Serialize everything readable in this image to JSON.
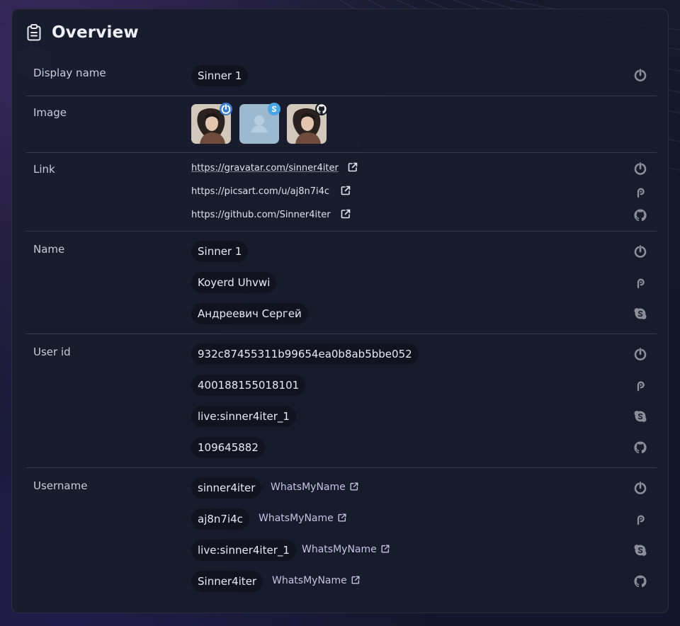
{
  "header": {
    "title": "Overview",
    "icon": "clipboard-icon"
  },
  "display_name": {
    "label": "Display name",
    "entries": [
      {
        "value": "Sinner 1",
        "service": "gravatar"
      }
    ]
  },
  "image": {
    "label": "Image",
    "avatars": [
      {
        "alt": "gravatar avatar",
        "badge": "gravatar"
      },
      {
        "alt": "skype default avatar",
        "badge": "skype"
      },
      {
        "alt": "github avatar",
        "badge": "github"
      }
    ]
  },
  "link": {
    "label": "Link",
    "entries": [
      {
        "url": "https://gravatar.com/sinner4iter",
        "service": "gravatar"
      },
      {
        "url": "https://picsart.com/u/aj8n7i4c",
        "service": "picsart"
      },
      {
        "url": "https://github.com/Sinner4iter",
        "service": "github"
      }
    ]
  },
  "name": {
    "label": "Name",
    "entries": [
      {
        "value": "Sinner 1",
        "service": "gravatar"
      },
      {
        "value": "Koyerd Uhvwi",
        "service": "picsart"
      },
      {
        "value": "Андреевич Сергей",
        "service": "skype"
      }
    ]
  },
  "user_id": {
    "label": "User id",
    "entries": [
      {
        "value": "932c87455311b99654ea0b8ab5bbe052",
        "service": "gravatar"
      },
      {
        "value": "400188155018101",
        "service": "picsart"
      },
      {
        "value": "live:sinner4iter_1",
        "service": "skype"
      },
      {
        "value": "109645882",
        "service": "github"
      }
    ]
  },
  "username": {
    "label": "Username",
    "entries": [
      {
        "value": "sinner4iter",
        "link": "WhatsMyName",
        "service": "gravatar"
      },
      {
        "value": "aj8n7i4c",
        "link": "WhatsMyName",
        "service": "picsart"
      },
      {
        "value": "live:sinner4iter_1",
        "link": "WhatsMyName",
        "service": "skype"
      },
      {
        "value": "Sinner4iter",
        "link": "WhatsMyName",
        "service": "github"
      }
    ]
  },
  "colors": {
    "background": "#141828",
    "panel": "#181c2c",
    "pill": "#11141f",
    "service_icon": "#8c8f9a",
    "whatsmyname_link": "#c7c2e4",
    "gravatar_badge": "#3b7fd0",
    "skype_badge": "#47a6e6"
  }
}
